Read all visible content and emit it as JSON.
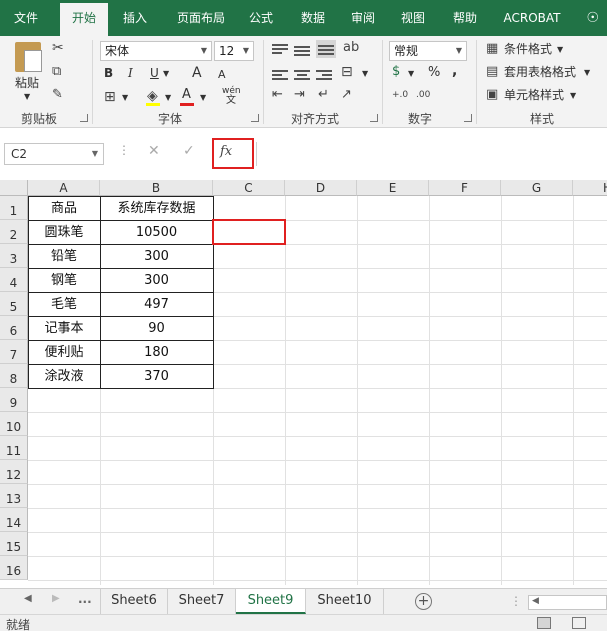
{
  "ribbon_tabs": [
    "文件",
    "开始",
    "插入",
    "页面布局",
    "公式",
    "数据",
    "审阅",
    "视图",
    "帮助",
    "ACROBAT"
  ],
  "active_tab": "开始",
  "clipboard": {
    "paste_label": "粘贴",
    "group_label": "剪贴板"
  },
  "font": {
    "name": "宋体",
    "size": "12",
    "group_label": "字体",
    "bold": "B",
    "italic": "I",
    "underline": "U",
    "grow": "A",
    "shrink": "A",
    "font_color": "A",
    "phonetic": "wén"
  },
  "alignment": {
    "group_label": "对齐方式"
  },
  "number": {
    "format": "常规",
    "group_label": "数字",
    "percent": "%",
    "comma": ","
  },
  "styles": {
    "conditional_format": "条件格式",
    "table_format": "套用表格格式",
    "cell_styles": "单元格样式",
    "group_label": "样式"
  },
  "formula_bar": {
    "name_box": "C2",
    "fx": "fx",
    "formula": ""
  },
  "columns": [
    "A",
    "B",
    "C",
    "D",
    "E",
    "F",
    "G",
    "H"
  ],
  "rows": [
    "1",
    "2",
    "3",
    "4",
    "5",
    "6",
    "7",
    "8",
    "9",
    "10",
    "11",
    "12",
    "13",
    "14",
    "15",
    "16"
  ],
  "table": {
    "headers": [
      "商品",
      "系统库存数据"
    ],
    "rows": [
      [
        "圆珠笔",
        "10500"
      ],
      [
        "铅笔",
        "300"
      ],
      [
        "钢笔",
        "300"
      ],
      [
        "毛笔",
        "497"
      ],
      [
        "记事本",
        "90"
      ],
      [
        "便利贴",
        "180"
      ],
      [
        "涂改液",
        "370"
      ]
    ]
  },
  "selected_cell": "C2",
  "sheets": [
    "Sheet6",
    "Sheet7",
    "Sheet9",
    "Sheet10"
  ],
  "active_sheet": "Sheet9",
  "sheet_nav": {
    "ellipsis": "..."
  },
  "status": "就绪",
  "colors": {
    "brand": "#217346",
    "highlight": "#e02020"
  }
}
